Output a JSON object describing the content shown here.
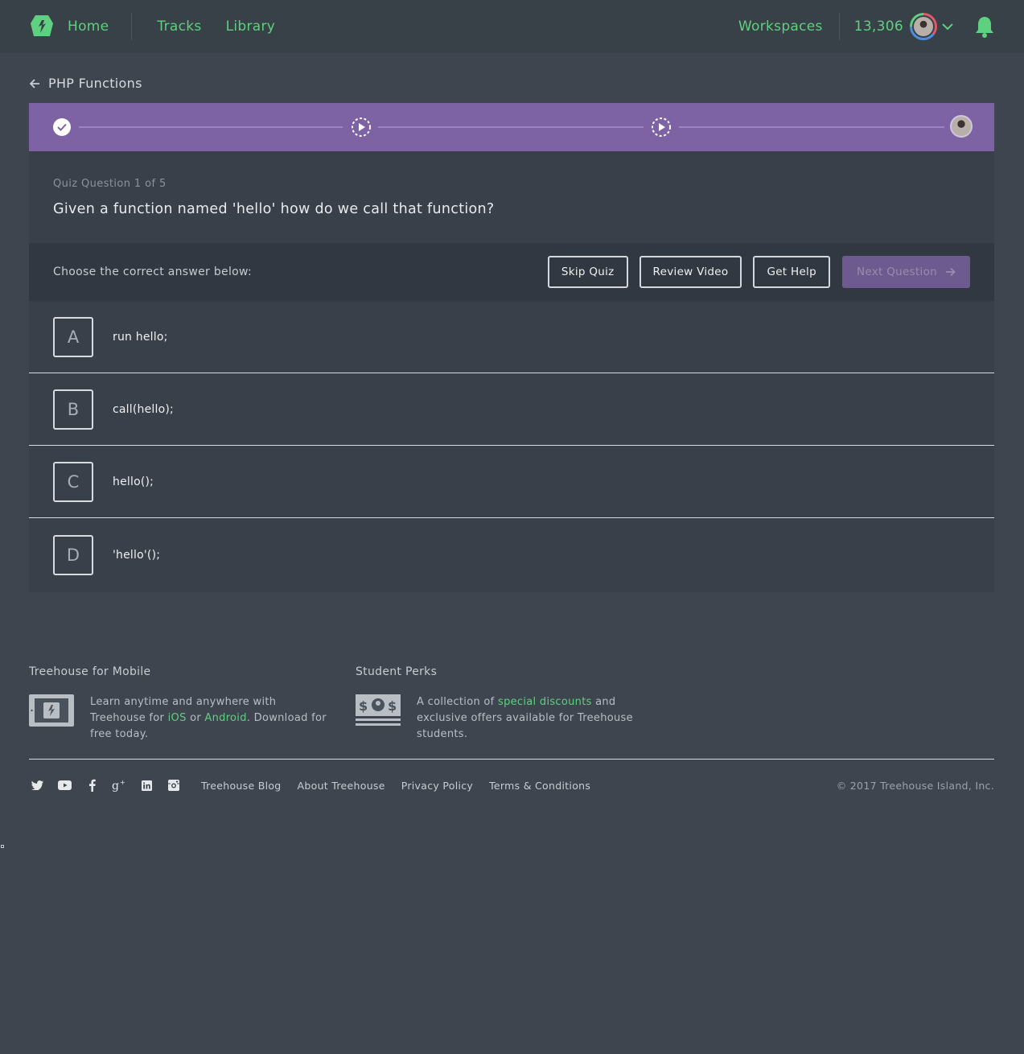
{
  "nav": {
    "home": "Home",
    "tracks": "Tracks",
    "library": "Library",
    "workspaces": "Workspaces",
    "points": "13,306"
  },
  "breadcrumb": {
    "title": "PHP Functions"
  },
  "progress": {
    "steps": [
      "completed",
      "video",
      "video",
      "avatar"
    ]
  },
  "quiz": {
    "counter": "Quiz Question 1 of 5",
    "question": "Given a function named 'hello' how do we call that function?",
    "instruction": "Choose the correct answer below:",
    "buttons": {
      "skip": "Skip Quiz",
      "review": "Review Video",
      "help": "Get Help",
      "next": "Next Question"
    },
    "answers": [
      {
        "letter": "A",
        "text": "run hello;"
      },
      {
        "letter": "B",
        "text": "call(hello);"
      },
      {
        "letter": "C",
        "text": "hello();"
      },
      {
        "letter": "D",
        "text": "'hello'();"
      }
    ]
  },
  "footer": {
    "mobile": {
      "title": "Treehouse for Mobile",
      "text_a": "Learn anytime and anywhere with Treehouse for ",
      "ios": "iOS",
      "or": " or ",
      "android": "Android",
      "text_b": ". Download for free today."
    },
    "perks": {
      "title": "Student Perks",
      "text_a": "A collection of ",
      "link": "special discounts",
      "text_b": " and exclusive offers available for Treehouse students."
    },
    "links": [
      "Treehouse Blog",
      "About Treehouse",
      "Privacy Policy",
      "Terms & Conditions"
    ],
    "copyright": "© 2017 Treehouse Island, Inc."
  },
  "colors": {
    "accent": "#5fcf80",
    "progress_bar": "#7d62a4",
    "background": "#3e454f"
  }
}
